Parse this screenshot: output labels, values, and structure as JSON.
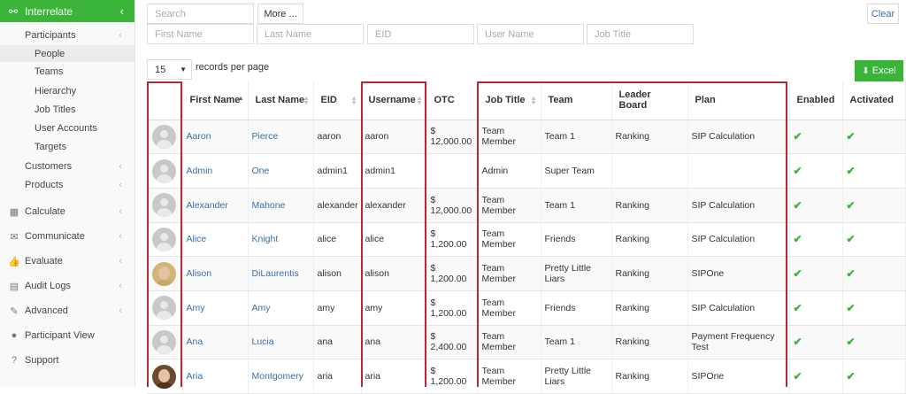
{
  "sidebar": {
    "header": "Interrelate",
    "items": {
      "participants": "Participants",
      "people": "People",
      "teams": "Teams",
      "hierarchy": "Hierarchy",
      "job_titles": "Job Titles",
      "user_accounts": "User Accounts",
      "targets": "Targets",
      "customers": "Customers",
      "products": "Products",
      "calculate": "Calculate",
      "communicate": "Communicate",
      "evaluate": "Evaluate",
      "audit_logs": "Audit Logs",
      "advanced": "Advanced",
      "participant_view": "Participant View",
      "support": "Support"
    }
  },
  "filters": {
    "search": "Search",
    "more": "More ...",
    "clear": "Clear",
    "first_name": "First Name",
    "last_name": "Last Name",
    "eid": "EID",
    "user_name": "User Name",
    "job_title": "Job Title"
  },
  "paging": {
    "per_page_value": "15",
    "per_page_label": "records per page"
  },
  "excel_label": "Excel",
  "colors": {
    "accent": "#3ab53a",
    "link": "#3a6ea5",
    "highlight": "#b22a3a"
  },
  "table": {
    "headers": {
      "first_name": "First Name",
      "last_name": "Last Name",
      "eid": "EID",
      "username": "Username",
      "otc": "OTC",
      "job_title": "Job Title",
      "team": "Team",
      "leader_board": "Leader Board",
      "plan": "Plan",
      "enabled": "Enabled",
      "activated": "Activated"
    },
    "rows": [
      {
        "avatar": "default",
        "first": "Aaron",
        "last": "Pierce",
        "eid": "aaron",
        "user": "aaron",
        "otc": "$ 12,000.00",
        "job": "Team Member",
        "team": "Team 1",
        "board": "Ranking",
        "plan": "SIP Calculation",
        "enabled": "✔",
        "activated": "✔"
      },
      {
        "avatar": "default",
        "first": "Admin",
        "last": "One",
        "eid": "admin1",
        "user": "admin1",
        "otc": "",
        "job": "Admin",
        "team": "Super Team",
        "board": "",
        "plan": "",
        "enabled": "✔",
        "activated": "✔"
      },
      {
        "avatar": "default",
        "first": "Alexander",
        "last": "Mahone",
        "eid": "alexander",
        "user": "alexander",
        "otc": "$ 12,000.00",
        "job": "Team Member",
        "team": "Team 1",
        "board": "Ranking",
        "plan": "SIP Calculation",
        "enabled": "✔",
        "activated": "✔"
      },
      {
        "avatar": "default",
        "first": "Alice",
        "last": "Knight",
        "eid": "alice",
        "user": "alice",
        "otc": "$ 1,200.00",
        "job": "Team Member",
        "team": "Friends",
        "board": "Ranking",
        "plan": "SIP Calculation",
        "enabled": "✔",
        "activated": "✔"
      },
      {
        "avatar": "photo-blonde",
        "first": "Alison",
        "last": "DiLaurentis",
        "eid": "alison",
        "user": "alison",
        "otc": "$ 1,200.00",
        "job": "Team Member",
        "team": "Pretty Little Liars",
        "board": "Ranking",
        "plan": "SIPOne",
        "enabled": "✔",
        "activated": "✔"
      },
      {
        "avatar": "default",
        "first": "Amy",
        "last": "Amy",
        "eid": "amy",
        "user": "amy",
        "otc": "$ 1,200.00",
        "job": "Team Member",
        "team": "Friends",
        "board": "Ranking",
        "plan": "SIP Calculation",
        "enabled": "✔",
        "activated": "✔"
      },
      {
        "avatar": "default",
        "first": "Ana",
        "last": "Lucia",
        "eid": "ana",
        "user": "ana",
        "otc": "$ 2,400.00",
        "job": "Team Member",
        "team": "Team 1",
        "board": "Ranking",
        "plan": "Payment Frequency Test",
        "enabled": "✔",
        "activated": "✔"
      },
      {
        "avatar": "photo-dark",
        "first": "Aria",
        "last": "Montgomery",
        "eid": "aria",
        "user": "aria",
        "otc": "$ 1,200.00",
        "job": "Team Member",
        "team": "Pretty Little Liars",
        "board": "Ranking",
        "plan": "SIPOne",
        "enabled": "✔",
        "activated": "✔"
      }
    ]
  }
}
